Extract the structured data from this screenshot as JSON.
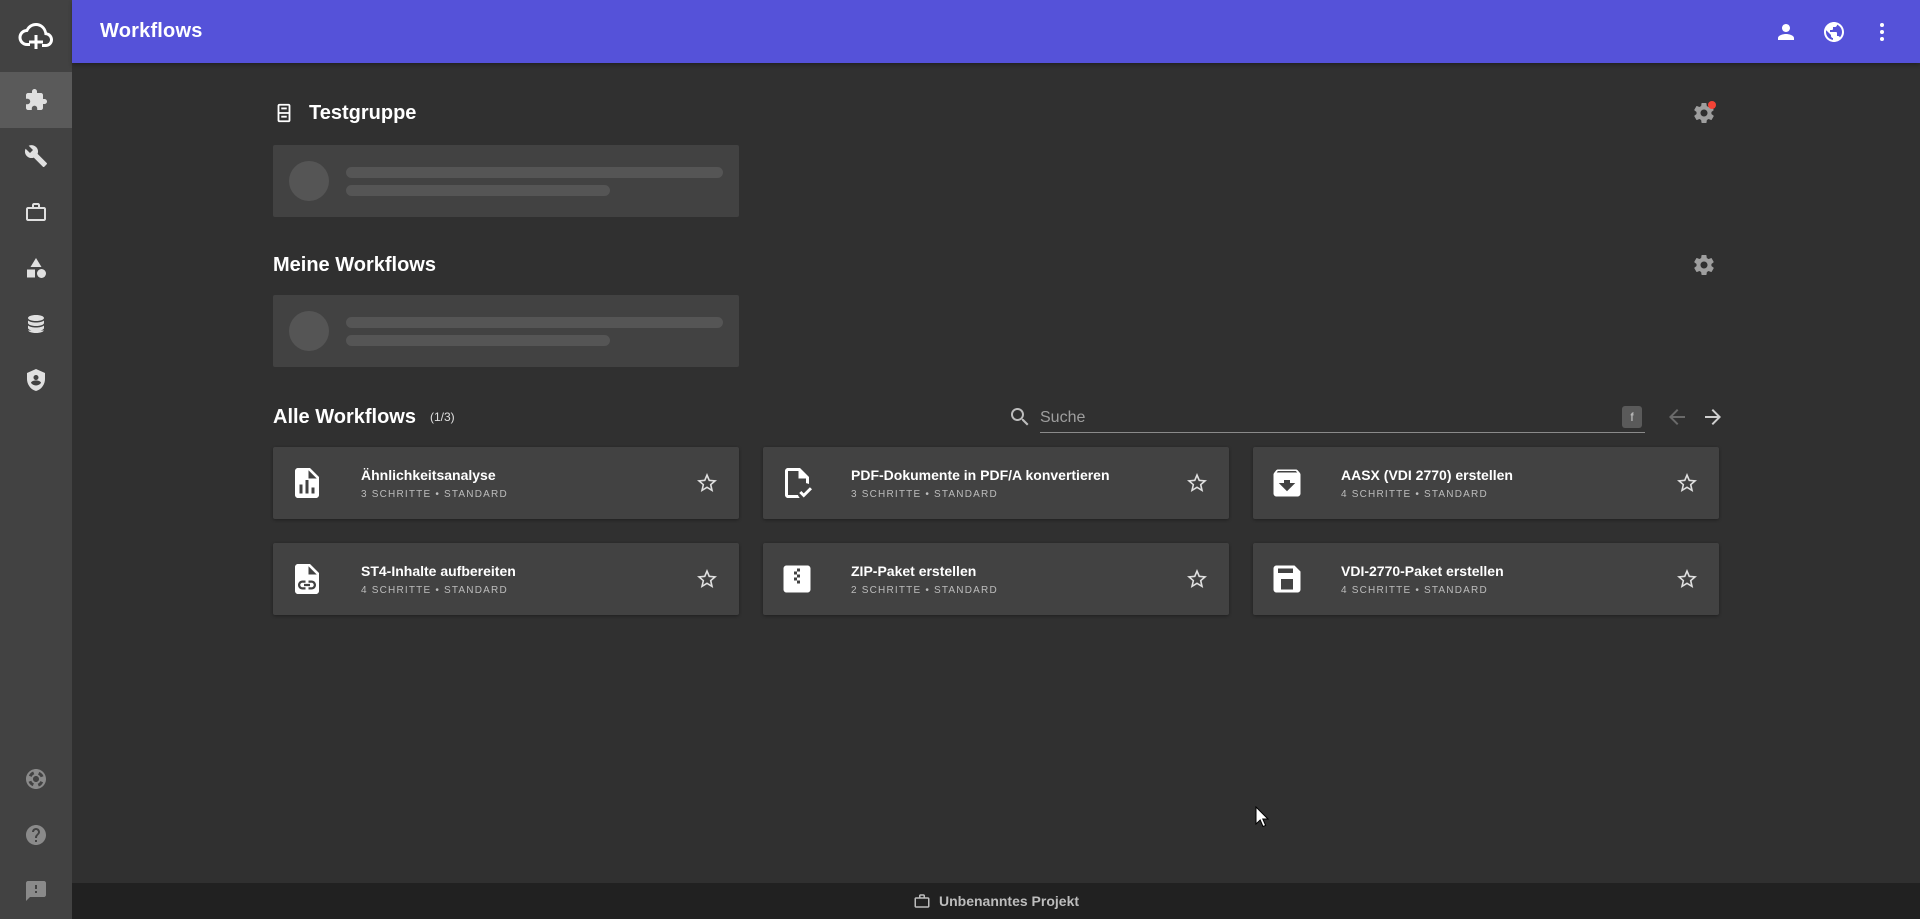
{
  "app": {
    "title": "Workflows"
  },
  "sidebar": {
    "items": [
      {
        "name": "extensions",
        "icon": "puzzle-icon",
        "active": true
      },
      {
        "name": "tools",
        "icon": "wrench-icon",
        "active": false
      },
      {
        "name": "projects",
        "icon": "briefcase-icon",
        "active": false
      },
      {
        "name": "shapes",
        "icon": "shapes-icon",
        "active": false
      },
      {
        "name": "database",
        "icon": "database-icon",
        "active": false
      },
      {
        "name": "security",
        "icon": "shield-icon",
        "active": false
      }
    ],
    "bottom_items": [
      {
        "name": "support",
        "icon": "lifebuoy-icon"
      },
      {
        "name": "help",
        "icon": "help-icon"
      },
      {
        "name": "feedback",
        "icon": "feedback-icon"
      }
    ]
  },
  "topbar": {
    "actions": [
      "account-icon",
      "globe-icon",
      "more-vert-icon"
    ]
  },
  "sections": {
    "group": {
      "title": "Testgruppe",
      "has_notification": true
    },
    "mine": {
      "title": "Meine Workflows"
    },
    "all": {
      "title": "Alle Workflows",
      "page_info": "(1/3)"
    }
  },
  "search": {
    "placeholder": "Suche",
    "shortcut": "f"
  },
  "workflows": [
    {
      "title": "Ähnlichkeitsanalyse",
      "subtitle": "3 SCHRITTE • STANDARD",
      "icon": "chart-file-icon"
    },
    {
      "title": "PDF-Dokumente in PDF/A konvertieren",
      "subtitle": "3 SCHRITTE • STANDARD",
      "icon": "file-check-icon"
    },
    {
      "title": "AASX (VDI 2770) erstellen",
      "subtitle": "4 SCHRITTE • STANDARD",
      "icon": "archive-icon"
    },
    {
      "title": "ST4-Inhalte aufbereiten",
      "subtitle": "4 SCHRITTE • STANDARD",
      "icon": "file-link-icon"
    },
    {
      "title": "ZIP-Paket erstellen",
      "subtitle": "2 SCHRITTE • STANDARD",
      "icon": "zip-icon"
    },
    {
      "title": "VDI-2770-Paket erstellen",
      "subtitle": "4 SCHRITTE • STANDARD",
      "icon": "save-icon"
    }
  ],
  "footer": {
    "project_name": "Unbenanntes Projekt"
  },
  "colors": {
    "accent": "#5552d9",
    "background": "#303030",
    "card": "#424242",
    "sidebar": "#424242",
    "footer": "#212121",
    "notification": "#f44336"
  }
}
